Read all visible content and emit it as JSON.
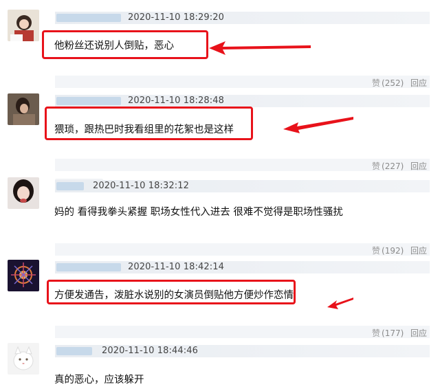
{
  "comments": [
    {
      "timestamp": "2020-11-10 18:29:20",
      "text": "他粉丝还说别人倒贴，恶心",
      "likes": "(252)",
      "reply": "回应",
      "highlighted": true
    },
    {
      "timestamp": "2020-11-10 18:28:48",
      "text": "猥琐，跟热巴时我看组里的花絮也是这样",
      "likes": "(227)",
      "reply": "回应",
      "highlighted": true
    },
    {
      "timestamp": "2020-11-10 18:32:12",
      "text": "妈的 看得我拳头紧握 职场女性代入进去 很难不觉得是职场性骚扰",
      "likes": "(192)",
      "reply": "回应",
      "highlighted": false
    },
    {
      "timestamp": "2020-11-10 18:42:14",
      "text": "方便发通告，泼脏水说别的女演员倒贴他方便炒作恋情",
      "likes": "(177)",
      "reply": "回应",
      "highlighted": true
    },
    {
      "timestamp": "2020-11-10 18:44:46",
      "text": "真的恶心，应该躲开",
      "highlighted": false
    }
  ],
  "like_icon": "thumbs-up-icon",
  "colors": {
    "highlight": "#e8121a",
    "header_bg": "#eef1f5"
  }
}
